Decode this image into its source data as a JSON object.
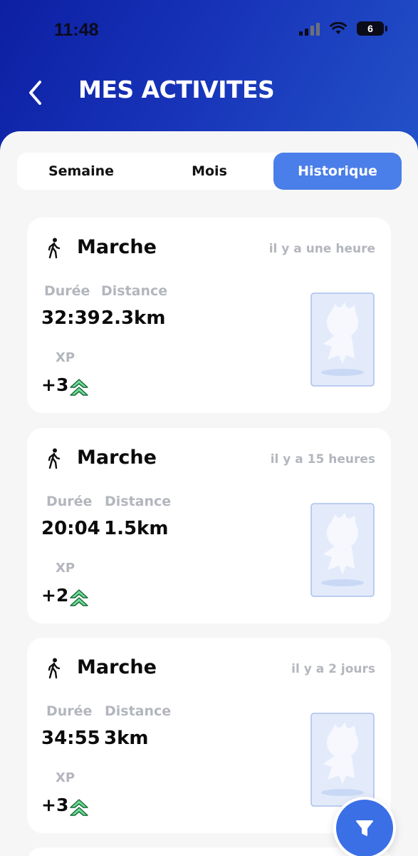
{
  "status_bar": {
    "time": "11:48",
    "battery": "6"
  },
  "header": {
    "title": "MES ACTIVITES"
  },
  "tabs": [
    {
      "label": "Semaine",
      "active": false
    },
    {
      "label": "Mois",
      "active": false
    },
    {
      "label": "Historique",
      "active": true
    }
  ],
  "activities": [
    {
      "type": "Marche",
      "when": "il y a une heure",
      "duration_label": "Durée",
      "duration": "32:39",
      "distance_label": "Distance",
      "distance": "2.3km",
      "xp_label": "XP",
      "xp": "+3"
    },
    {
      "type": "Marche",
      "when": "il y a 15 heures",
      "duration_label": "Durée",
      "duration": "20:04",
      "distance_label": "Distance",
      "distance": "1.5km",
      "xp_label": "XP",
      "xp": "+2"
    },
    {
      "type": "Marche",
      "when": "il y a 2 jours",
      "duration_label": "Durée",
      "duration": "34:55",
      "distance_label": "Distance",
      "distance": "3km",
      "xp_label": "XP",
      "xp": "+3"
    }
  ],
  "icons": {
    "back": "chevron-left-icon",
    "activity": "walking-icon",
    "xp": "double-chevron-up-icon",
    "filter": "filter-icon"
  },
  "colors": {
    "header_gradient_start": "#0d1fa3",
    "header_gradient_end": "#2352c9",
    "active_tab": "#4a7ee8",
    "fab": "#3a6fe6",
    "xp_green": "#5fd38a"
  }
}
